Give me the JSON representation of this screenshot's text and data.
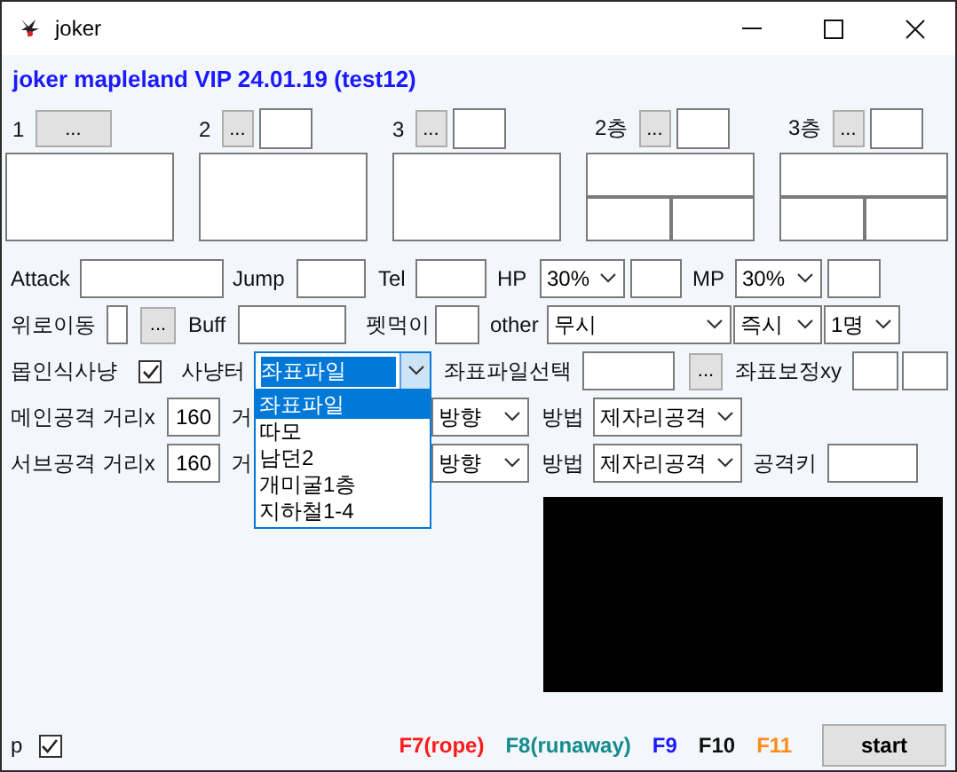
{
  "window": {
    "title": "joker"
  },
  "header": "joker mapleland VIP 24.01.19 (test12)",
  "slots": [
    {
      "label": "1",
      "button": "...",
      "kind": "wide",
      "box": {
        "kind": "single"
      }
    },
    {
      "label": "2",
      "button": "...",
      "kind": "field",
      "box": {
        "kind": "single"
      }
    },
    {
      "label": "3",
      "button": "...",
      "kind": "field",
      "box": {
        "kind": "single"
      }
    },
    {
      "label": "2층",
      "button": "...",
      "kind": "field",
      "box": {
        "kind": "split"
      }
    },
    {
      "label": "3층",
      "button": "...",
      "kind": "field",
      "box": {
        "kind": "split"
      }
    }
  ],
  "rows": [
    {
      "items": [
        {
          "kind": "label",
          "text": "Attack"
        },
        {
          "kind": "field"
        },
        {
          "kind": "label",
          "text": "Jump"
        },
        {
          "kind": "field"
        },
        {
          "kind": "label",
          "text": "Tel"
        },
        {
          "kind": "field"
        },
        {
          "kind": "label",
          "text": "HP"
        },
        {
          "kind": "combo",
          "value": "30%",
          "expanded": false
        },
        {
          "kind": "field"
        },
        {
          "kind": "label",
          "text": "MP"
        },
        {
          "kind": "combo",
          "value": "30%",
          "expanded": false
        },
        {
          "kind": "field"
        }
      ]
    },
    {
      "items": [
        {
          "kind": "label",
          "text": "위로이동"
        },
        {
          "kind": "field"
        },
        {
          "kind": "button",
          "text": "..."
        },
        {
          "kind": "label",
          "text": "Buff"
        },
        {
          "kind": "field"
        },
        {
          "kind": "label",
          "text": "펫먹이"
        },
        {
          "kind": "field"
        },
        {
          "kind": "label",
          "text": "other"
        },
        {
          "kind": "combo",
          "value": "무시",
          "expanded": false
        },
        {
          "kind": "combo",
          "value": "즉시",
          "expanded": false
        },
        {
          "kind": "combo",
          "value": "1명",
          "expanded": false
        }
      ]
    },
    {
      "items": [
        {
          "kind": "label",
          "text": "몹인식사냥"
        },
        {
          "kind": "checkbox",
          "checked": true
        },
        {
          "kind": "label",
          "text": "사냥터"
        },
        {
          "kind": "combo",
          "value": "좌표파일",
          "expanded": true,
          "options": [
            {
              "text": "좌표파일",
              "selected": true
            },
            {
              "text": "따모",
              "selected": false
            },
            {
              "text": "남던2",
              "selected": false
            },
            {
              "text": "개미굴1층",
              "selected": false
            },
            {
              "text": "지하철1-4",
              "selected": false
            }
          ]
        },
        {
          "kind": "label",
          "text": "좌표파일선택"
        },
        {
          "kind": "field"
        },
        {
          "kind": "button",
          "text": "..."
        },
        {
          "kind": "label",
          "text": "좌표보정xy"
        },
        {
          "kind": "field"
        },
        {
          "kind": "field"
        }
      ]
    },
    {
      "items": [
        {
          "kind": "label",
          "text": "메인공격 거리x"
        },
        {
          "kind": "field",
          "value": "160"
        },
        {
          "kind": "label",
          "text": "거"
        },
        {
          "kind": "combo",
          "value": "방향",
          "expanded": false
        },
        {
          "kind": "label",
          "text": "방법"
        },
        {
          "kind": "combo",
          "value": "제자리공격",
          "expanded": false
        }
      ]
    },
    {
      "items": [
        {
          "kind": "label",
          "text": "서브공격 거리x"
        },
        {
          "kind": "field",
          "value": "160"
        },
        {
          "kind": "label",
          "text": "거"
        },
        {
          "kind": "combo",
          "value": "방향",
          "expanded": false
        },
        {
          "kind": "label",
          "text": "방법"
        },
        {
          "kind": "combo",
          "value": "제자리공격",
          "expanded": false
        },
        {
          "kind": "label",
          "text": "공격키"
        },
        {
          "kind": "field"
        }
      ]
    }
  ],
  "footer": {
    "p_label": "p",
    "p_checked": true,
    "hotkeys": [
      {
        "text": "F7(rope)",
        "color": "#ff1a1a"
      },
      {
        "text": "F8(runaway)",
        "color": "#148c8c"
      },
      {
        "text": "F9",
        "color": "#1a1aff"
      },
      {
        "text": "F10",
        "color": "#111111"
      },
      {
        "text": "F11",
        "color": "#ff8c1a"
      }
    ],
    "start": "start"
  }
}
